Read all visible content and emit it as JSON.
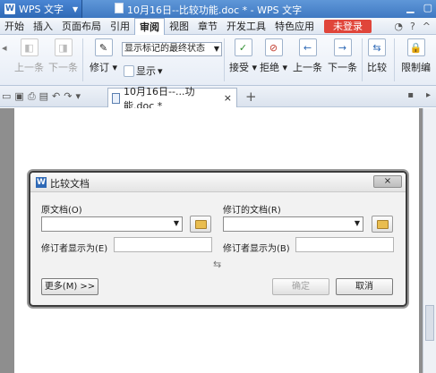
{
  "app": {
    "name": "WPS 文字",
    "logo": "W",
    "window_title": "10月16日--比较功能.doc * - WPS 文字"
  },
  "menu": {
    "items": [
      "开始",
      "插入",
      "页面布局",
      "引用",
      "审阅",
      "视图",
      "章节",
      "开发工具",
      "特色应用"
    ],
    "active": "审阅",
    "login": "未登录"
  },
  "ribbon": {
    "prev_label": "上一条",
    "next_label": "下一条",
    "revise_label": "修订",
    "display_label": "显示",
    "markup_select": "显示标记的最终状态",
    "accept_label": "接受",
    "reject_label": "拒绝",
    "prev_change_label": "上一条",
    "next_change_label": "下一条",
    "compare_label": "比较",
    "restrict_label": "限制编"
  },
  "tab": {
    "doc_name": "10月16日--...功能.doc *",
    "close": "×",
    "add": "+"
  },
  "dialog": {
    "title": "比较文档",
    "close": "×",
    "original_label": "原文档(O)",
    "revised_label": "修订的文档(R)",
    "original_reviser_label": "修订者显示为(E)",
    "revised_reviser_label": "修订者显示为(B)",
    "more_button": "更多(M) >>",
    "ok_button": "确定",
    "cancel_button": "取消",
    "swap_icon": "⇆"
  },
  "colors": {
    "accent": "#3f79c2",
    "login": "#e0453a"
  }
}
